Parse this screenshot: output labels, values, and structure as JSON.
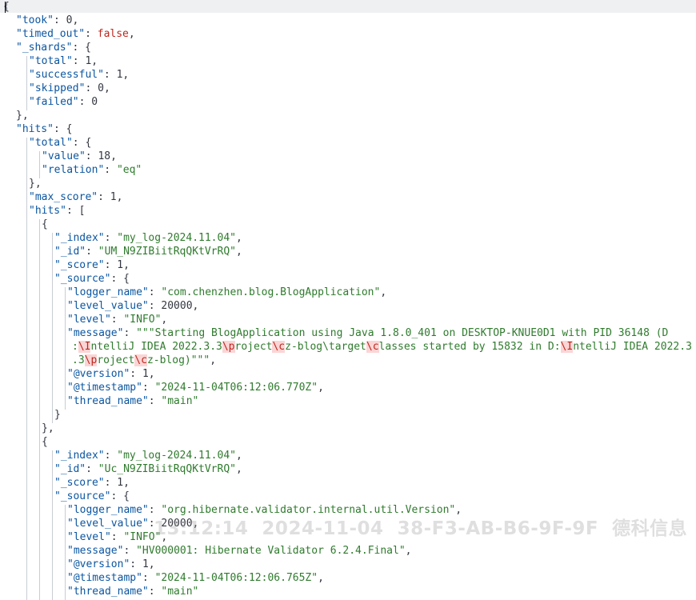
{
  "editor": {
    "lines": [
      {
        "indent": 0,
        "parts": [
          [
            "p",
            "{"
          ]
        ]
      },
      {
        "indent": 1,
        "parts": [
          [
            "k",
            "\"took\""
          ],
          [
            "p",
            ": "
          ],
          [
            "n",
            "0"
          ],
          [
            "p",
            ","
          ]
        ]
      },
      {
        "indent": 1,
        "parts": [
          [
            "k",
            "\"timed_out\""
          ],
          [
            "p",
            ": "
          ],
          [
            "b",
            "false"
          ],
          [
            "p",
            ","
          ]
        ]
      },
      {
        "indent": 1,
        "parts": [
          [
            "k",
            "\"_shards\""
          ],
          [
            "p",
            ": {"
          ]
        ]
      },
      {
        "indent": 2,
        "parts": [
          [
            "k",
            "\"total\""
          ],
          [
            "p",
            ": "
          ],
          [
            "n",
            "1"
          ],
          [
            "p",
            ","
          ]
        ]
      },
      {
        "indent": 2,
        "parts": [
          [
            "k",
            "\"successful\""
          ],
          [
            "p",
            ": "
          ],
          [
            "n",
            "1"
          ],
          [
            "p",
            ","
          ]
        ]
      },
      {
        "indent": 2,
        "parts": [
          [
            "k",
            "\"skipped\""
          ],
          [
            "p",
            ": "
          ],
          [
            "n",
            "0"
          ],
          [
            "p",
            ","
          ]
        ]
      },
      {
        "indent": 2,
        "parts": [
          [
            "k",
            "\"failed\""
          ],
          [
            "p",
            ": "
          ],
          [
            "n",
            "0"
          ]
        ]
      },
      {
        "indent": 1,
        "parts": [
          [
            "p",
            "},"
          ]
        ]
      },
      {
        "indent": 1,
        "parts": [
          [
            "k",
            "\"hits\""
          ],
          [
            "p",
            ": {"
          ]
        ]
      },
      {
        "indent": 2,
        "parts": [
          [
            "k",
            "\"total\""
          ],
          [
            "p",
            ": {"
          ]
        ]
      },
      {
        "indent": 3,
        "parts": [
          [
            "k",
            "\"value\""
          ],
          [
            "p",
            ": "
          ],
          [
            "n",
            "18"
          ],
          [
            "p",
            ","
          ]
        ]
      },
      {
        "indent": 3,
        "parts": [
          [
            "k",
            "\"relation\""
          ],
          [
            "p",
            ": "
          ],
          [
            "s",
            "\"eq\""
          ]
        ]
      },
      {
        "indent": 2,
        "parts": [
          [
            "p",
            "},"
          ]
        ]
      },
      {
        "indent": 2,
        "parts": [
          [
            "k",
            "\"max_score\""
          ],
          [
            "p",
            ": "
          ],
          [
            "n",
            "1"
          ],
          [
            "p",
            ","
          ]
        ]
      },
      {
        "indent": 2,
        "parts": [
          [
            "k",
            "\"hits\""
          ],
          [
            "p",
            ": ["
          ]
        ]
      },
      {
        "indent": 3,
        "parts": [
          [
            "p",
            "{"
          ]
        ]
      },
      {
        "indent": 4,
        "parts": [
          [
            "k",
            "\"_index\""
          ],
          [
            "p",
            ": "
          ],
          [
            "s",
            "\"my_log-2024.11.04\""
          ],
          [
            "p",
            ","
          ]
        ]
      },
      {
        "indent": 4,
        "parts": [
          [
            "k",
            "\"_id\""
          ],
          [
            "p",
            ": "
          ],
          [
            "s",
            "\"UM_N9ZIBiitRqQKtVrRQ\""
          ],
          [
            "p",
            ","
          ]
        ]
      },
      {
        "indent": 4,
        "parts": [
          [
            "k",
            "\"_score\""
          ],
          [
            "p",
            ": "
          ],
          [
            "n",
            "1"
          ],
          [
            "p",
            ","
          ]
        ]
      },
      {
        "indent": 4,
        "parts": [
          [
            "k",
            "\"_source\""
          ],
          [
            "p",
            ": {"
          ]
        ]
      },
      {
        "indent": 5,
        "parts": [
          [
            "k",
            "\"logger_name\""
          ],
          [
            "p",
            ": "
          ],
          [
            "s",
            "\"com.chenzhen.blog.BlogApplication\""
          ],
          [
            "p",
            ","
          ]
        ]
      },
      {
        "indent": 5,
        "parts": [
          [
            "k",
            "\"level_value\""
          ],
          [
            "p",
            ": "
          ],
          [
            "n",
            "20000"
          ],
          [
            "p",
            ","
          ]
        ]
      },
      {
        "indent": 5,
        "parts": [
          [
            "k",
            "\"level\""
          ],
          [
            "p",
            ": "
          ],
          [
            "s",
            "\"INFO\""
          ],
          [
            "p",
            ","
          ]
        ]
      },
      {
        "indent": 5,
        "parts": [
          [
            "k",
            "\"message\""
          ],
          [
            "p",
            ": "
          ],
          [
            "s",
            "\"\"\"Starting BlogApplication using Java 1.8.0_401 on DESKTOP-KNUE0D1 with PID 36148 (D"
          ]
        ]
      },
      {
        "indent": 5,
        "cont": true,
        "parts": [
          [
            "s",
            ":"
          ],
          [
            "esc",
            "\\I"
          ],
          [
            "s",
            "ntelliJ IDEA 2022.3.3"
          ],
          [
            "esc",
            "\\p"
          ],
          [
            "s",
            "roject"
          ],
          [
            "esc",
            "\\c"
          ],
          [
            "s",
            "z-blog\\target"
          ],
          [
            "esc",
            "\\c"
          ],
          [
            "s",
            "lasses started by 15832 in D:"
          ],
          [
            "esc",
            "\\I"
          ],
          [
            "s",
            "ntelliJ IDEA 2022.3"
          ]
        ]
      },
      {
        "indent": 5,
        "cont": true,
        "parts": [
          [
            "s",
            ".3"
          ],
          [
            "esc",
            "\\p"
          ],
          [
            "s",
            "roject"
          ],
          [
            "esc",
            "\\c"
          ],
          [
            "s",
            "z-blog)\"\"\""
          ],
          [
            "p",
            ","
          ]
        ]
      },
      {
        "indent": 5,
        "parts": [
          [
            "k",
            "\"@version\""
          ],
          [
            "p",
            ": "
          ],
          [
            "n",
            "1"
          ],
          [
            "p",
            ","
          ]
        ]
      },
      {
        "indent": 5,
        "parts": [
          [
            "k",
            "\"@timestamp\""
          ],
          [
            "p",
            ": "
          ],
          [
            "s",
            "\"2024-11-04T06:12:06.770Z\""
          ],
          [
            "p",
            ","
          ]
        ]
      },
      {
        "indent": 5,
        "parts": [
          [
            "k",
            "\"thread_name\""
          ],
          [
            "p",
            ": "
          ],
          [
            "s",
            "\"main\""
          ]
        ]
      },
      {
        "indent": 4,
        "parts": [
          [
            "p",
            "}"
          ]
        ]
      },
      {
        "indent": 3,
        "parts": [
          [
            "p",
            "},"
          ]
        ]
      },
      {
        "indent": 3,
        "parts": [
          [
            "p",
            "{"
          ]
        ]
      },
      {
        "indent": 4,
        "parts": [
          [
            "k",
            "\"_index\""
          ],
          [
            "p",
            ": "
          ],
          [
            "s",
            "\"my_log-2024.11.04\""
          ],
          [
            "p",
            ","
          ]
        ]
      },
      {
        "indent": 4,
        "parts": [
          [
            "k",
            "\"_id\""
          ],
          [
            "p",
            ": "
          ],
          [
            "s",
            "\"Uc_N9ZIBiitRqQKtVrRQ\""
          ],
          [
            "p",
            ","
          ]
        ]
      },
      {
        "indent": 4,
        "parts": [
          [
            "k",
            "\"_score\""
          ],
          [
            "p",
            ": "
          ],
          [
            "n",
            "1"
          ],
          [
            "p",
            ","
          ]
        ]
      },
      {
        "indent": 4,
        "parts": [
          [
            "k",
            "\"_source\""
          ],
          [
            "p",
            ": {"
          ]
        ]
      },
      {
        "indent": 5,
        "parts": [
          [
            "k",
            "\"logger_name\""
          ],
          [
            "p",
            ": "
          ],
          [
            "s",
            "\"org.hibernate.validator.internal.util.Version\""
          ],
          [
            "p",
            ","
          ]
        ]
      },
      {
        "indent": 5,
        "parts": [
          [
            "k",
            "\"level_value\""
          ],
          [
            "p",
            ": "
          ],
          [
            "n",
            "20000"
          ],
          [
            "p",
            ","
          ]
        ]
      },
      {
        "indent": 5,
        "parts": [
          [
            "k",
            "\"level\""
          ],
          [
            "p",
            ": "
          ],
          [
            "s",
            "\"INFO\""
          ],
          [
            "p",
            ","
          ]
        ]
      },
      {
        "indent": 5,
        "parts": [
          [
            "k",
            "\"message\""
          ],
          [
            "p",
            ": "
          ],
          [
            "s",
            "\"HV000001: Hibernate Validator 6.2.4.Final\""
          ],
          [
            "p",
            ","
          ]
        ]
      },
      {
        "indent": 5,
        "parts": [
          [
            "k",
            "\"@version\""
          ],
          [
            "p",
            ": "
          ],
          [
            "n",
            "1"
          ],
          [
            "p",
            ","
          ]
        ]
      },
      {
        "indent": 5,
        "parts": [
          [
            "k",
            "\"@timestamp\""
          ],
          [
            "p",
            ": "
          ],
          [
            "s",
            "\"2024-11-04T06:12:06.765Z\""
          ],
          [
            "p",
            ","
          ]
        ]
      },
      {
        "indent": 5,
        "parts": [
          [
            "k",
            "\"thread_name\""
          ],
          [
            "p",
            ": "
          ],
          [
            "s",
            "\"main\""
          ]
        ]
      }
    ]
  },
  "watermark": {
    "text": "13:12:14  2024-11-04  38-F3-AB-B6-9F-9F  德科信息"
  },
  "colors": {
    "key": "#0b56a1",
    "string": "#2f7b2d",
    "number": "#343741",
    "boolean": "#bd271e",
    "escape_bg": "#fbd5d5",
    "guide": "#c8ccd2"
  }
}
